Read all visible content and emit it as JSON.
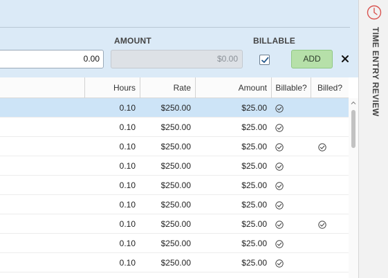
{
  "form": {
    "amount_label": "AMOUNT",
    "billable_label": "BILLABLE",
    "hours_value": "0.00",
    "amount_value": "$0.00",
    "billable_checked": true,
    "add_label": "ADD",
    "close_glyph": "✕"
  },
  "grid": {
    "columns": [
      "Hours",
      "Rate",
      "Amount",
      "Billable?",
      "Billed?"
    ],
    "rows": [
      {
        "hours": "0.10",
        "rate": "$250.00",
        "amount": "$25.00",
        "billable": true,
        "billed": false,
        "selected": true
      },
      {
        "hours": "0.10",
        "rate": "$250.00",
        "amount": "$25.00",
        "billable": true,
        "billed": false,
        "selected": false
      },
      {
        "hours": "0.10",
        "rate": "$250.00",
        "amount": "$25.00",
        "billable": true,
        "billed": true,
        "selected": false
      },
      {
        "hours": "0.10",
        "rate": "$250.00",
        "amount": "$25.00",
        "billable": true,
        "billed": false,
        "selected": false
      },
      {
        "hours": "0.10",
        "rate": "$250.00",
        "amount": "$25.00",
        "billable": true,
        "billed": false,
        "selected": false
      },
      {
        "hours": "0.10",
        "rate": "$250.00",
        "amount": "$25.00",
        "billable": true,
        "billed": false,
        "selected": false
      },
      {
        "hours": "0.10",
        "rate": "$250.00",
        "amount": "$25.00",
        "billable": true,
        "billed": true,
        "selected": false
      },
      {
        "hours": "0.10",
        "rate": "$250.00",
        "amount": "$25.00",
        "billable": true,
        "billed": false,
        "selected": false
      },
      {
        "hours": "0.10",
        "rate": "$250.00",
        "amount": "$25.00",
        "billable": true,
        "billed": false,
        "selected": false
      }
    ]
  },
  "side_panel": {
    "title": "TIME ENTRY REVIEW",
    "icon": "clock-icon"
  },
  "colors": {
    "panel_bg": "#dbeaf7",
    "selected_row": "#cde4f7",
    "add_button": "#b6e0a9",
    "clock_accent": "#d9534f"
  }
}
